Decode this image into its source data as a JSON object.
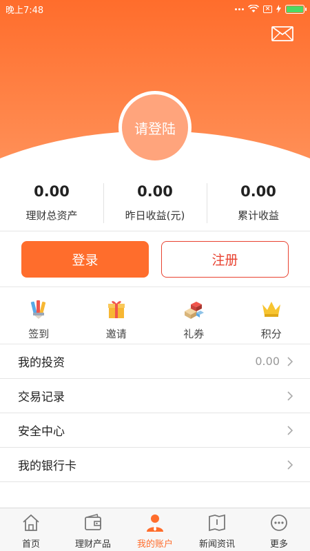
{
  "status_bar": {
    "time": "晚上7:48",
    "accent": "#4cd964"
  },
  "header": {
    "avatar_label": "请登陆",
    "accent": "#ff6d2c",
    "mail_icon": "mail-icon"
  },
  "stats": [
    {
      "value": "0.00",
      "label": "理财总资产"
    },
    {
      "value": "0.00",
      "label": "昨日收益(元)"
    },
    {
      "value": "0.00",
      "label": "累计收益"
    }
  ],
  "buttons": {
    "login": "登录",
    "register": "注册"
  },
  "quick_actions": [
    {
      "label": "签到",
      "icon": "pencils-icon"
    },
    {
      "label": "邀请",
      "icon": "gift-icon"
    },
    {
      "label": "礼券",
      "icon": "blocks-icon"
    },
    {
      "label": "积分",
      "icon": "crown-icon"
    }
  ],
  "menu": [
    {
      "label": "我的投资",
      "value": "0.00"
    },
    {
      "label": "交易记录",
      "value": ""
    },
    {
      "label": "安全中心",
      "value": ""
    },
    {
      "label": "我的银行卡",
      "value": ""
    }
  ],
  "tabs": [
    {
      "label": "首页",
      "icon": "home-icon",
      "active": false
    },
    {
      "label": "理财产品",
      "icon": "wallet-icon",
      "active": false
    },
    {
      "label": "我的账户",
      "icon": "user-icon",
      "active": true
    },
    {
      "label": "新闻资讯",
      "icon": "news-icon",
      "active": false
    },
    {
      "label": "更多",
      "icon": "more-icon",
      "active": false
    }
  ]
}
